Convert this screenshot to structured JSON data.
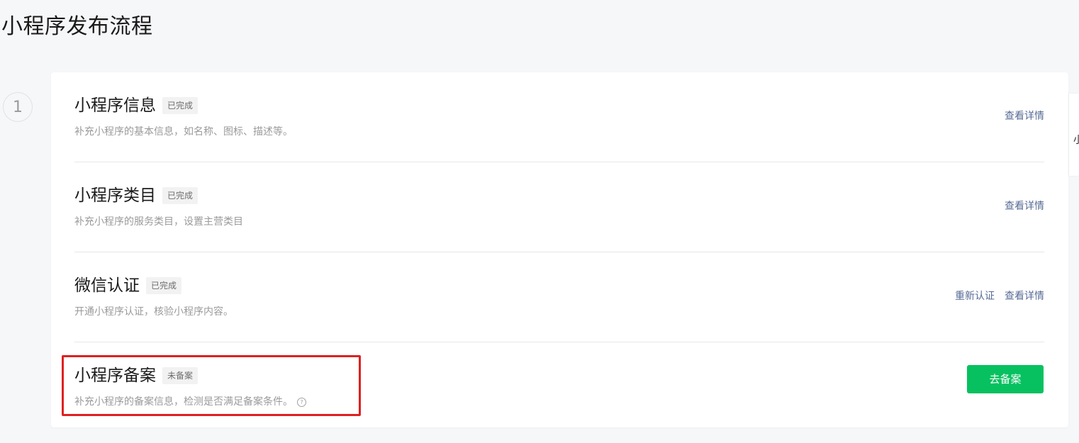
{
  "page": {
    "title": "小程序发布流程"
  },
  "step": {
    "number": "1"
  },
  "items": [
    {
      "title": "小程序信息",
      "status": "已完成",
      "description": "补充小程序的基本信息，如名称、图标、描述等。",
      "actions": [
        "查看详情"
      ]
    },
    {
      "title": "小程序类目",
      "status": "已完成",
      "description": "补充小程序的服务类目，设置主营类目",
      "actions": [
        "查看详情"
      ]
    },
    {
      "title": "微信认证",
      "status": "已完成",
      "description": "开通小程序认证，核验小程序内容。",
      "actions": [
        "重新认证",
        "查看详情"
      ]
    },
    {
      "title": "小程序备案",
      "status": "未备案",
      "description": "补充小程序的备案信息，检测是否满足备案条件。",
      "help_icon": "?",
      "primary_action": "去备案"
    }
  ],
  "side_tab": {
    "text": "小"
  },
  "colors": {
    "link": "#576b95",
    "primary": "#07c160",
    "highlight": "#e02020"
  }
}
